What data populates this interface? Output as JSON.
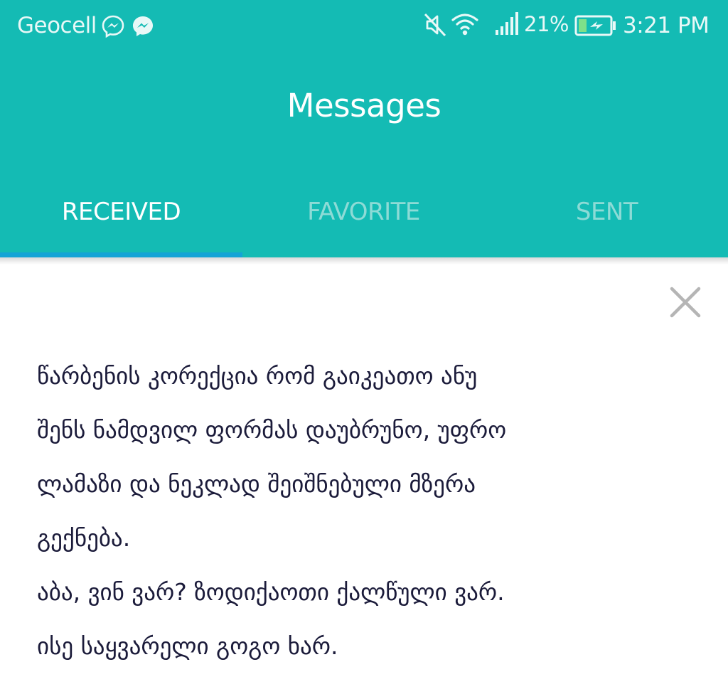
{
  "status_bar": {
    "carrier": "Geocell",
    "battery_percent": "21%",
    "time": "3:21 PM",
    "icons": [
      "messenger-outline-icon",
      "messenger-icon",
      "mute-icon",
      "wifi-icon",
      "signal-icon",
      "battery-charging-icon"
    ]
  },
  "header": {
    "title": "Messages"
  },
  "tabs": [
    {
      "label": "RECEIVED",
      "active": true
    },
    {
      "label": "FAVORITE",
      "active": false
    },
    {
      "label": "SENT",
      "active": false
    }
  ],
  "message": {
    "lines": [
      "წარბენის კორექცია რომ გაიკეათო ანუ",
      "შენს ნამდვილ ფორმას დაუბრუნო, უფრო",
      "ლამაზი და ნეკლად შეიშნებული მზერა",
      "გექნება.",
      "აბა, ვინ ვარ? ზოდიქაოთი ქალწული ვარ.",
      "ისე საყვარელი გოგო ხარ."
    ]
  },
  "colors": {
    "app_bar": "#14bbb4",
    "tab_indicator": "#14a4d6",
    "inactive_tab": "#8ddbd6",
    "message_text": "#1b1b3a",
    "close_icon": "#b5b5b5"
  }
}
